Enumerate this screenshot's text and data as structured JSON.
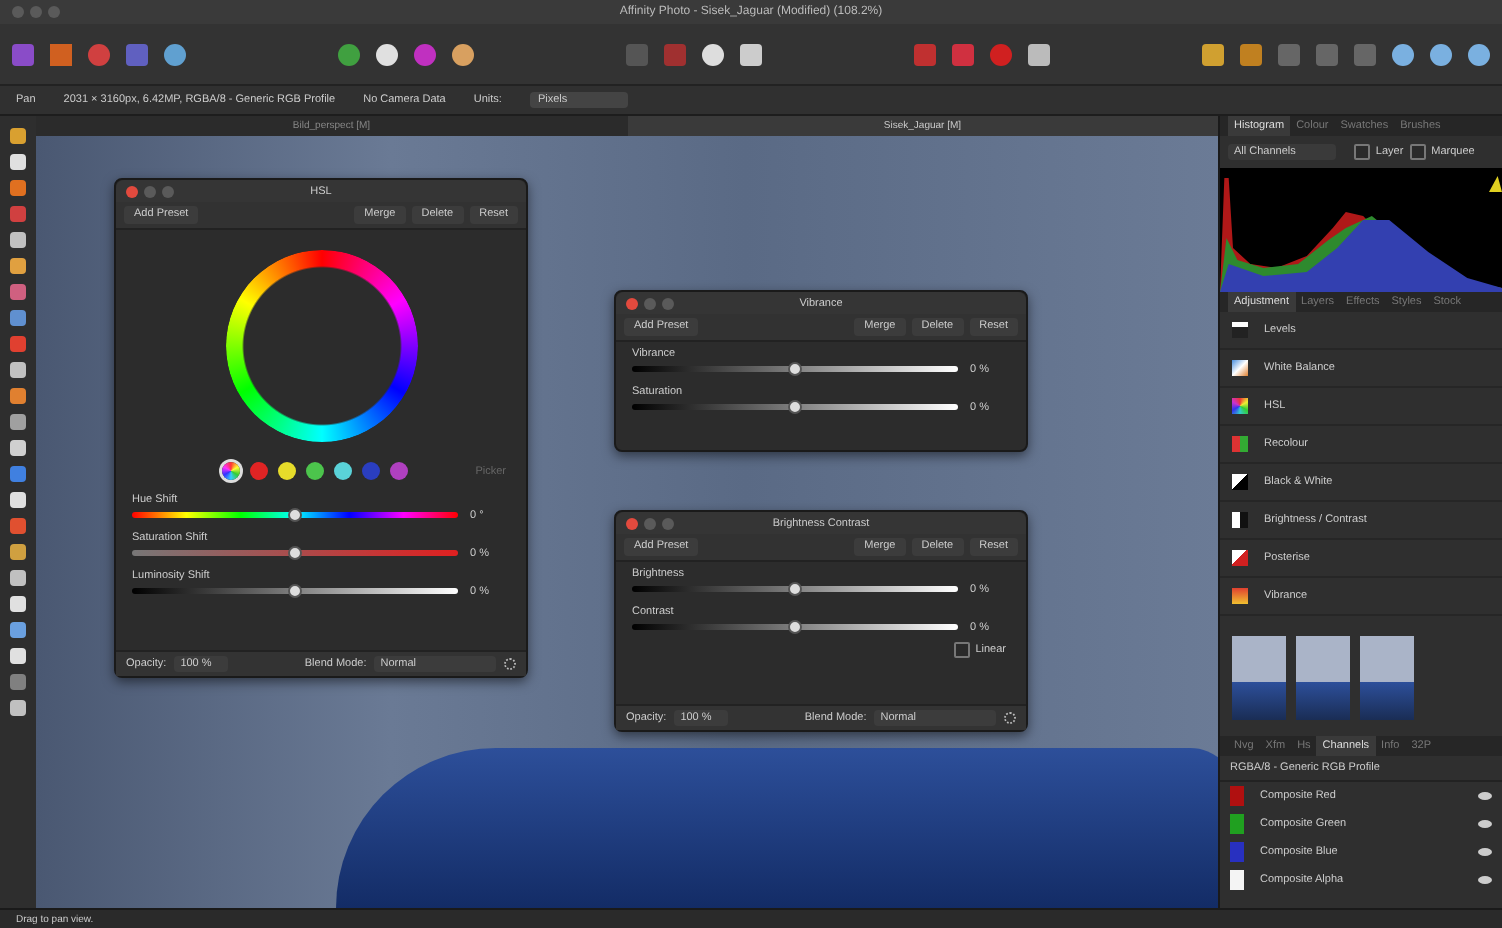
{
  "window": {
    "title": "Affinity Photo - Sisek_Jaguar (Modified) (108.2%)"
  },
  "context_bar": {
    "tool": "Pan",
    "info": "2031 × 3160px, 6.42MP, RGBA/8 - Generic RGB Profile",
    "camera": "No Camera Data",
    "units_label": "Units:",
    "units_value": "Pixels"
  },
  "doc_tabs": [
    {
      "label": "Bild_perspect [M]",
      "selected": false
    },
    {
      "label": "Sisek_Jaguar [M]",
      "selected": true
    }
  ],
  "panels": [
    {
      "kind": "hsl",
      "title": "HSL",
      "add": "Add Preset",
      "buttons": [
        "Merge",
        "Delete",
        "Reset"
      ],
      "swatches": [
        {
          "kind": "wheel",
          "selected": true
        },
        {
          "kind": "color",
          "color": "#e02424",
          "selected": false
        },
        {
          "kind": "color",
          "color": "#e6dc2a",
          "selected": false
        },
        {
          "kind": "color",
          "color": "#4cc44c",
          "selected": false
        },
        {
          "kind": "color",
          "color": "#5ad2d8",
          "selected": false
        },
        {
          "kind": "color",
          "color": "#2a3ec0",
          "selected": false
        },
        {
          "kind": "color",
          "color": "#b040c0",
          "selected": false
        }
      ],
      "picker": "Picker",
      "sliders": [
        {
          "label": "Hue Shift",
          "kind": "hue",
          "level": 0.5,
          "reading": "0 °"
        },
        {
          "label": "Saturation Shift",
          "kind": "saturation",
          "level": 0.5,
          "reading": "0 %"
        },
        {
          "label": "Luminosity Shift",
          "kind": "luminosity",
          "level": 0.5,
          "reading": "0 %"
        }
      ],
      "footer": {
        "opacity_label": "Opacity:",
        "opacity": "100 %",
        "blend_label": "Blend Mode:",
        "blend": "Normal"
      }
    },
    {
      "kind": "basic",
      "title": "Vibrance",
      "add": "Add Preset",
      "buttons": [
        "Merge",
        "Delete",
        "Reset"
      ],
      "sliders": [
        {
          "label": "Vibrance",
          "kind": "luminosity",
          "level": 0.5,
          "reading": "0 %"
        },
        {
          "label": "Saturation",
          "kind": "luminosity",
          "level": 0.5,
          "reading": "0 %"
        }
      ]
    },
    {
      "kind": "basic",
      "title": "Brightness Contrast",
      "add": "Add Preset",
      "buttons": [
        "Merge",
        "Delete",
        "Reset"
      ],
      "sliders": [
        {
          "label": "Brightness",
          "kind": "luminosity",
          "level": 0.5,
          "reading": "0 %"
        },
        {
          "label": "Contrast",
          "kind": "luminosity",
          "level": 0.5,
          "reading": "0 %"
        }
      ],
      "option": {
        "label": "Linear",
        "checked": false
      },
      "footer": {
        "opacity_label": "Opacity:",
        "opacity": "100 %",
        "blend_label": "Blend Mode:",
        "blend": "Normal"
      }
    }
  ],
  "right_panel": {
    "top_tabs": [
      {
        "label": "Histogram",
        "selected": true
      },
      {
        "label": "Colour",
        "selected": false
      },
      {
        "label": "Swatches",
        "selected": false
      },
      {
        "label": "Brushes",
        "selected": false
      }
    ],
    "channel_select": "All Channels",
    "checkboxes": [
      {
        "label": "Layer",
        "checked": false
      },
      {
        "label": "Marquee",
        "checked": false
      }
    ],
    "adjustment_tabs": [
      {
        "label": "Adjustment",
        "selected": true
      },
      {
        "label": "Layers",
        "selected": false
      },
      {
        "label": "Effects",
        "selected": false
      },
      {
        "label": "Styles",
        "selected": false
      },
      {
        "label": "Stock",
        "selected": false
      }
    ],
    "adjustments": [
      {
        "kind": "levels",
        "label": "Levels"
      },
      {
        "kind": "white-balance",
        "label": "White Balance"
      },
      {
        "kind": "hsl",
        "label": "HSL"
      },
      {
        "kind": "recolour",
        "label": "Recolour"
      },
      {
        "kind": "black-white",
        "label": "Black & White"
      },
      {
        "kind": "brightness-contrast",
        "label": "Brightness / Contrast"
      },
      {
        "kind": "posterise",
        "label": "Posterise"
      },
      {
        "kind": "vibrance",
        "label": "Vibrance"
      }
    ],
    "bottom_tabs": [
      {
        "label": "Nvg",
        "selected": false
      },
      {
        "label": "Xfm",
        "selected": false
      },
      {
        "label": "Hs",
        "selected": false
      },
      {
        "label": "Channels",
        "selected": true
      },
      {
        "label": "Info",
        "selected": false
      },
      {
        "label": "32P",
        "selected": false
      }
    ],
    "profile": "RGBA/8 - Generic RGB Profile",
    "channels": [
      {
        "label": "Composite Red",
        "color": "#b01010"
      },
      {
        "label": "Composite Green",
        "color": "#20a020"
      },
      {
        "label": "Composite Blue",
        "color": "#2830c0"
      },
      {
        "label": "Composite Alpha",
        "color": "#f4f4f4"
      }
    ]
  },
  "status_bar": {
    "hint": "Drag to pan view."
  }
}
